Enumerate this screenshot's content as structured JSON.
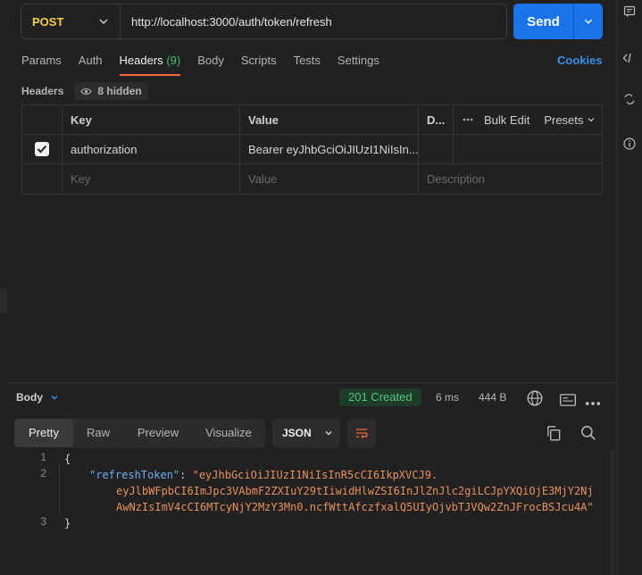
{
  "request": {
    "method": "POST",
    "url": "http://localhost:3000/auth/token/refresh",
    "send_label": "Send"
  },
  "tabs": [
    {
      "label": "Params"
    },
    {
      "label": "Auth"
    },
    {
      "label": "Headers",
      "count": "(9)",
      "active": true
    },
    {
      "label": "Body"
    },
    {
      "label": "Scripts"
    },
    {
      "label": "Tests"
    },
    {
      "label": "Settings"
    }
  ],
  "cookies_label": "Cookies",
  "headers_section": {
    "title": "Headers",
    "hidden_label": "8 hidden",
    "columns": {
      "key": "Key",
      "value": "Value",
      "description": "D...",
      "bulk_edit": "Bulk Edit",
      "presets": "Presets"
    },
    "rows": [
      {
        "checked": true,
        "key": "authorization",
        "value": "Bearer eyJhbGciOiJIUzI1NiIsIn..."
      }
    ],
    "placeholders": {
      "key": "Key",
      "value": "Value",
      "description": "Description"
    }
  },
  "response": {
    "body_label": "Body",
    "status": "201 Created",
    "time": "6 ms",
    "size": "444 B",
    "view_tabs": [
      {
        "label": "Pretty",
        "active": true
      },
      {
        "label": "Raw"
      },
      {
        "label": "Preview"
      },
      {
        "label": "Visualize"
      }
    ],
    "format": "JSON",
    "code": {
      "line_numbers": [
        "1",
        "2",
        "3"
      ],
      "open_brace": "{",
      "key": "\"refreshToken\"",
      "colon": ": ",
      "value_line1": "\"eyJhbGciOiJIUzI1NiIsInR5cCI6IkpXVCJ9.",
      "value_line2": "eyJlbWFpbCI6ImJpc3VAbmF2ZXIuY29tIiwidHlwZSI6InJlZnJlc2giLCJpYXQiOjE3MjY2Nj",
      "value_line3": "AwNzIsImV4cCI6MTcyNjY2MzY3Mn0.ncfWttAfczfxalQ5UIyOjvbTJVQw2ZnJFrocBSJcu4A\"",
      "close_brace": "}"
    }
  },
  "icons": [
    "chevron-down-icon",
    "eye-icon",
    "check-icon",
    "ellipsis-icon",
    "globe-icon",
    "save-response-icon",
    "more-icon",
    "wrap-lines-icon",
    "copy-icon",
    "search-icon",
    "comments-icon",
    "code-icon",
    "rename-icon",
    "info-icon"
  ],
  "colors": {
    "method": "#f4d03f",
    "send": "#1a73e8",
    "active_tab_underline": "#f26b3a",
    "status": "#4cc97a",
    "json_key": "#6ab0f3",
    "json_string": "#e8915a"
  }
}
